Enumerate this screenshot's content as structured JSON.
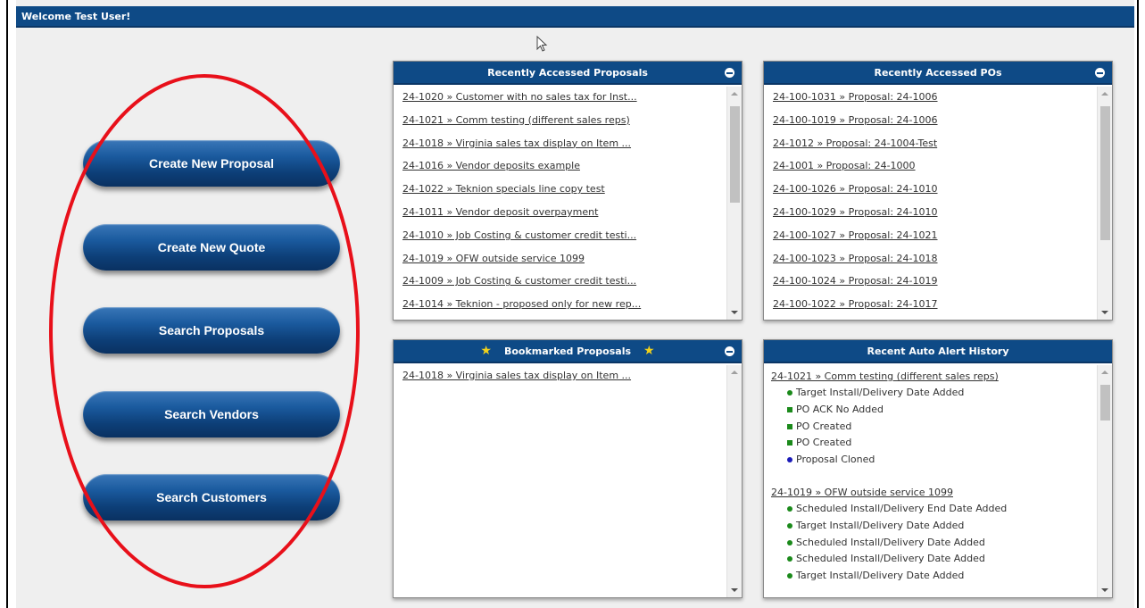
{
  "header": {
    "welcome": "Welcome Test User!"
  },
  "actions": [
    "Create New Proposal",
    "Create New Quote",
    "Search Proposals",
    "Search Vendors",
    "Search Customers"
  ],
  "recent_proposals": {
    "title": "Recently Accessed Proposals",
    "items": [
      "24-1020 » Customer with no sales tax for Inst...",
      "24-1021 » Comm testing (different sales reps)",
      "24-1018 » Virginia sales tax display on Item ...",
      "24-1016 » Vendor deposits example",
      "24-1022 » Teknion specials line copy test",
      "24-1011 » Vendor deposit overpayment",
      "24-1010 » Job Costing & customer credit testi...",
      "24-1019 » OFW outside service 1099",
      "24-1009 » Job Costing & customer credit testi...",
      "24-1014 » Teknion - proposed only for new rep..."
    ]
  },
  "recent_pos": {
    "title": "Recently Accessed POs",
    "items": [
      "24-100-1031 » Proposal: 24-1006",
      "24-100-1019 » Proposal: 24-1006",
      "24-1012 » Proposal: 24-1004-Test",
      "24-1001 » Proposal: 24-1000",
      "24-100-1026 » Proposal: 24-1010",
      "24-100-1029 » Proposal: 24-1010",
      "24-100-1027 » Proposal: 24-1021",
      "24-100-1023 » Proposal: 24-1018",
      "24-100-1024 » Proposal: 24-1019",
      "24-100-1022 » Proposal: 24-1017"
    ]
  },
  "bookmarked": {
    "title": "Bookmarked Proposals",
    "items": [
      "24-1018 » Virginia sales tax display on Item ..."
    ]
  },
  "alerts": {
    "title": "Recent Auto Alert History",
    "groups": [
      {
        "title": "24-1021 » Comm testing (different sales reps)",
        "items": [
          {
            "text": "Target Install/Delivery Date Added",
            "bullet": "circle",
            "color": "#1b8a1b"
          },
          {
            "text": "PO ACK No Added",
            "bullet": "square",
            "color": "#1b8a1b"
          },
          {
            "text": "PO Created",
            "bullet": "square",
            "color": "#1b8a1b"
          },
          {
            "text": "PO Created",
            "bullet": "square",
            "color": "#1b8a1b"
          },
          {
            "text": "Proposal Cloned",
            "bullet": "circle",
            "color": "#1a1ab8"
          }
        ]
      },
      {
        "title": "24-1019 » OFW outside service 1099",
        "items": [
          {
            "text": "Scheduled Install/Delivery End Date Added",
            "bullet": "circle",
            "color": "#1b8a1b"
          },
          {
            "text": "Target Install/Delivery Date Added",
            "bullet": "circle",
            "color": "#1b8a1b"
          },
          {
            "text": "Scheduled Install/Delivery Date Added",
            "bullet": "circle",
            "color": "#1b8a1b"
          },
          {
            "text": "Scheduled Install/Delivery Date Added",
            "bullet": "circle",
            "color": "#1b8a1b"
          },
          {
            "text": "Target Install/Delivery Date Added",
            "bullet": "circle",
            "color": "#1b8a1b"
          }
        ]
      }
    ]
  },
  "colors": {
    "header_blue": "#0e4a86",
    "annotation_red": "#e8101a",
    "background": "#efefef"
  }
}
